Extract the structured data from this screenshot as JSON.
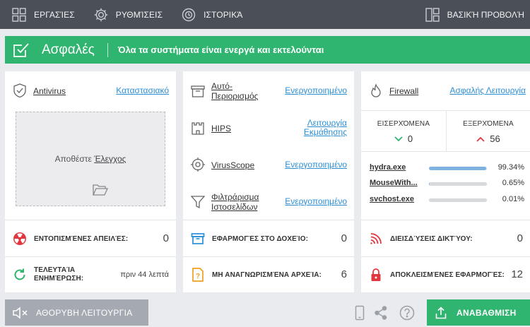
{
  "nav": {
    "tasks": "ΕΡΓΑΣΊΕΣ",
    "settings": "ΡΥΘΜΊΣΕΙΣ",
    "history": "ΙΣΤΟΡΙΚΆ",
    "basic_view": "ΒΑΣΙΚΉ ΠΡΟΒΟΛΉ"
  },
  "status": {
    "title": "Ασφαλές",
    "message": "Όλα τα συστήματα είναι ενεργά και εκτελούνται"
  },
  "panel1": {
    "antivirus_name": "Antivirus",
    "antivirus_status": "Καταστασιακό",
    "drop_text": "Αποθέστε",
    "drop_link": "Έλεγχος",
    "threats_label": "ΕΝΤΟΠΙΣΜΈΝΕΣ ΑΠΕΙΛΈΣ:",
    "threats_value": "0",
    "update_label_1": "ΤΕΛΕΥΤΑΊΑ",
    "update_label_2": "ΕΝΗΜΈΡΩΣΗ:",
    "update_value": "πριν 44 λεπτά"
  },
  "panel2": {
    "features": [
      {
        "name_1": "Αυτό-",
        "name_2": "Περιορισμός",
        "status_1": "Ενεργοποιημένο",
        "status_2": ""
      },
      {
        "name_1": "HIPS",
        "name_2": "",
        "status_1": "Λειτουργία",
        "status_2": "Εκμάθησης"
      },
      {
        "name_1": "VirusScope",
        "name_2": "",
        "status_1": "Ενεργοποιημένο",
        "status_2": ""
      },
      {
        "name_1": "Φιλτράρισμα",
        "name_2": "Ιστοσελίδων",
        "status_1": "Ενεργοποιημένο",
        "status_2": ""
      }
    ],
    "container_label": "ΕΦΑΡΜΟΓΈΣ ΣΤΟ ΔΟΧΕΊΟ:",
    "container_value": "0",
    "unknown_label": "ΜΗ ΑΝΑΓΝΩΡΙΣΜΈΝΑ ΑΡΧΕΊΑ:",
    "unknown_value": "6"
  },
  "panel3": {
    "firewall_name": "Firewall",
    "firewall_status": "Ασφαλής Λειτουργία",
    "incoming_label": "ΕΙΣΕΡΧΌΜΕΝΑ",
    "incoming_value": "0",
    "outgoing_label": "ΕΞΕΡΧΌΜΕΝΑ",
    "outgoing_value": "56",
    "processes": [
      {
        "name": "hydra.exe",
        "percent": "99.34%",
        "fraction": 0.9934
      },
      {
        "name": "MouseWith...",
        "percent": "0.65%",
        "fraction": 0.0065
      },
      {
        "name": "svchost.exe",
        "percent": "0.01%",
        "fraction": 0.0001
      }
    ],
    "connections_label": "ΔΙΕΙΣΔΎΣΕΙΣ ΔΙΚΤΎΟΥ:",
    "connections_value": "0",
    "blocked_label": "ΑΠΟΚΛΕΙΣΜΈΝΕΣ ΕΦΑΡΜΟΓΈΣ:",
    "blocked_value": "12"
  },
  "bottom": {
    "silent_mode": "ΑΘΟΡΥΒΗ ΛΕΙΤΟΥΡΓΙΑ",
    "update": "ΑΝΑΒΑΘΜΙΣΗ",
    "icons": [
      "mobile-icon",
      "share-icon",
      "help-icon"
    ]
  },
  "colors": {
    "accent_green": "#2fb56f",
    "topbar": "#4b4f57",
    "link_blue": "#2b8fd6",
    "danger_red": "#e0383e",
    "warning_orange": "#f0a020"
  }
}
